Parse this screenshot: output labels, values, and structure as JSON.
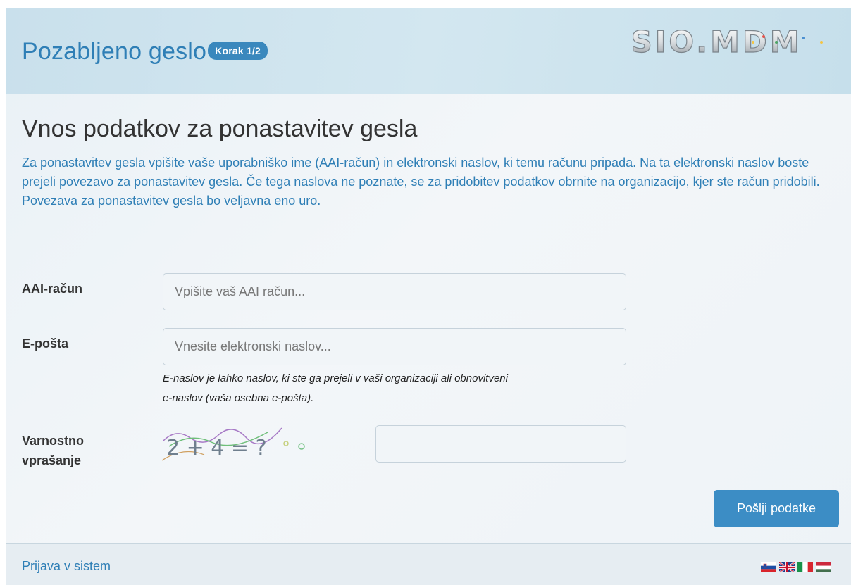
{
  "header": {
    "title": "Pozabljeno geslo",
    "step_badge": "Korak 1/2",
    "logo_text": "SIO.MDM"
  },
  "main": {
    "heading": "Vnos podatkov za ponastavitev gesla",
    "intro_lines": [
      "Za ponastavitev gesla vpišite vaše uporabniško ime (AAI-račun) in elektronski naslov, ki temu računu pripada. Na ta elektronski naslov boste prejeli povezavo za ponastavitev gesla. Če tega naslova ne poznate, se za pridobitev podatkov obrnite na organizacijo, kjer ste račun pridobili.",
      "Povezava za ponastavitev gesla bo veljavna eno uro."
    ]
  },
  "form": {
    "account": {
      "label": "AAI-račun",
      "placeholder": "Vpišite vaš AAI račun...",
      "value": ""
    },
    "email": {
      "label": "E-pošta",
      "placeholder": "Vnesite elektronski naslov...",
      "value": "",
      "help_line1": "E-naslov je lahko naslov, ki ste ga prejeli v vaši organizaciji ali obnovitveni",
      "help_line2": "e-naslov (vaša osebna e-pošta)."
    },
    "captcha": {
      "label_line1": "Varnostno",
      "label_line2": "vprašanje",
      "question": "2 + 4 = ?",
      "value": ""
    },
    "submit_label": "Pošlji podatke"
  },
  "footer": {
    "login_link": "Prijava v sistem",
    "languages": [
      "sl",
      "en",
      "it",
      "hu"
    ]
  },
  "colors": {
    "accent": "#2f7fb6",
    "button": "#3c8dc5",
    "badge": "#3a88bd"
  }
}
